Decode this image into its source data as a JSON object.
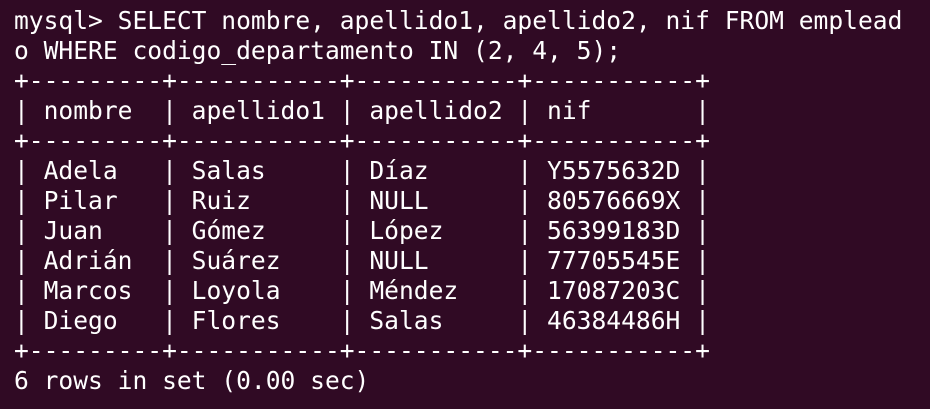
{
  "terminal": {
    "prompt_line_1": "mysql> SELECT nombre, apellido1, apellido2, nif FROM emplead",
    "prompt_line_2": "o WHERE codigo_departamento IN (2, 4, 5);",
    "border_top": "+---------+-----------+-----------+-----------+",
    "header_row": "| nombre  | apellido1 | apellido2 | nif       |",
    "border_mid": "+---------+-----------+-----------+-----------+",
    "rows": [
      "| Adela   | Salas     | Díaz      | Y5575632D |",
      "| Pilar   | Ruiz      | NULL      | 80576669X |",
      "| Juan    | Gómez     | López     | 56399183D |",
      "| Adrián  | Suárez    | NULL      | 77705545E |",
      "| Marcos  | Loyola    | Méndez    | 17087203C |",
      "| Diego   | Flores    | Salas     | 46384486H |"
    ],
    "border_bottom": "+---------+-----------+-----------+-----------+",
    "result_summary": "6 rows in set (0.00 sec)"
  },
  "colors": {
    "background": "#300a24",
    "foreground": "#ffffff"
  }
}
